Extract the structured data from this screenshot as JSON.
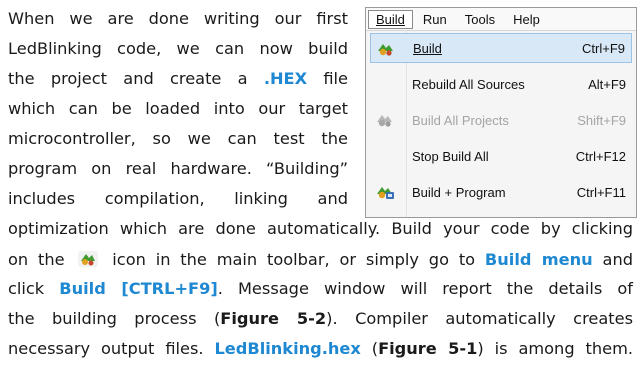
{
  "paragraph": {
    "l1": "When we are done writing our first",
    "l2": "LedBlinking code, we can now build",
    "l3a": "the project and create a ",
    "l3hex": ".HEX",
    "l3b": " file",
    "l4": "which can be loaded into our target",
    "l5": "microcontroller, so we can test the",
    "l6": "program on real hardware. “Building”",
    "l7": "includes compilation, linking and",
    "l8": "optimization which are done automatically. Build your code by clicking",
    "l9a": "on the",
    "l9b": "icon in the main toolbar, or simply go to ",
    "l9menu": "Build menu",
    "l9c": " and",
    "l10a": "click ",
    "l10build": "Build [CTRL+F9]",
    "l10b": ". Message window will report the details of",
    "l11a": "the building process (",
    "l11fig": "Figure 5-2",
    "l11b": "). Compiler automatically creates",
    "l12a": "necessary output files. ",
    "l12file": "LedBlinking.hex",
    "l12b": " (",
    "l12fig": "Figure 5-1",
    "l12c": ") is among them."
  },
  "menu": {
    "bar": {
      "build": "Build",
      "run": "Run",
      "tools": "Tools",
      "help": "Help"
    },
    "items": [
      {
        "label": "Build",
        "shortcut": "Ctrl+F9",
        "icon": "build-icon"
      },
      {
        "label": "Rebuild All Sources",
        "shortcut": "Alt+F9",
        "icon": ""
      },
      {
        "label": "Build All Projects",
        "shortcut": "Shift+F9",
        "icon": "build-all-icon"
      },
      {
        "label": "Stop Build All",
        "shortcut": "Ctrl+F12",
        "icon": ""
      },
      {
        "label": "Build + Program",
        "shortcut": "Ctrl+F11",
        "icon": "build-program-icon"
      }
    ]
  },
  "colors": {
    "highlight": "#1e88d2",
    "selection": "#d8e8f7",
    "disabled": "#a4a4a4"
  }
}
